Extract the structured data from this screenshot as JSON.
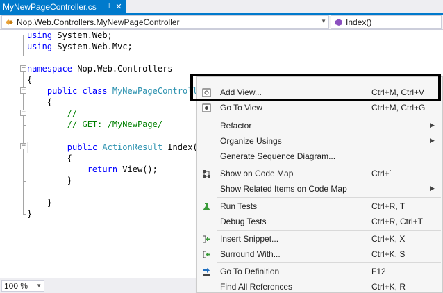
{
  "tab": {
    "title": "MyNewPageController.cs",
    "pin_icon": "pin-icon",
    "close_icon": "close-icon"
  },
  "nav": {
    "class_path": "Nop.Web.Controllers.MyNewPageController",
    "member": "Index()"
  },
  "code": {
    "l1": "using System.Web;",
    "l2": "using System.Web.Mvc;",
    "ns_kw": "namespace",
    "ns_name": " Nop.Web.Controllers",
    "brace_open": "{",
    "cls_kw": "    public class ",
    "cls_name": "MyNewPageControll",
    "brace_open2": "    {",
    "cm1": "        //",
    "cm2": "        // GET: /MyNewPage/",
    "m_kw": "        public ",
    "m_type": "ActionResult",
    "m_name": " Index()",
    "brace_open3": "        {",
    "ret_kw": "            return",
    "ret_rest": " View();",
    "brace_close3": "        }",
    "brace_close2": "    }",
    "brace_close": "}"
  },
  "zoom": {
    "value": "100 %"
  },
  "menu": {
    "items": [
      {
        "label": "Add View...",
        "shortcut": "Ctrl+M, Ctrl+V",
        "icon": "add-view-icon"
      },
      {
        "label": "Go To View",
        "shortcut": "Ctrl+M, Ctrl+G",
        "icon": "go-to-view-icon"
      },
      {
        "label": "Refactor",
        "shortcut": "",
        "icon": "",
        "submenu": true
      },
      {
        "label": "Organize Usings",
        "shortcut": "",
        "icon": "",
        "submenu": true
      },
      {
        "label": "Generate Sequence Diagram...",
        "shortcut": "",
        "icon": ""
      },
      {
        "label": "Show on Code Map",
        "shortcut": "Ctrl+`",
        "icon": "code-map-icon"
      },
      {
        "label": "Show Related Items on Code Map",
        "shortcut": "",
        "icon": "",
        "submenu": true
      },
      {
        "label": "Run Tests",
        "shortcut": "Ctrl+R, T",
        "icon": "run-tests-icon"
      },
      {
        "label": "Debug Tests",
        "shortcut": "Ctrl+R, Ctrl+T",
        "icon": ""
      },
      {
        "label": "Insert Snippet...",
        "shortcut": "Ctrl+K, X",
        "icon": "insert-snippet-icon"
      },
      {
        "label": "Surround With...",
        "shortcut": "Ctrl+K, S",
        "icon": "surround-with-icon"
      },
      {
        "label": "Go To Definition",
        "shortcut": "F12",
        "icon": "go-to-definition-icon"
      },
      {
        "label": "Find All References",
        "shortcut": "Ctrl+K, R",
        "icon": ""
      }
    ]
  }
}
